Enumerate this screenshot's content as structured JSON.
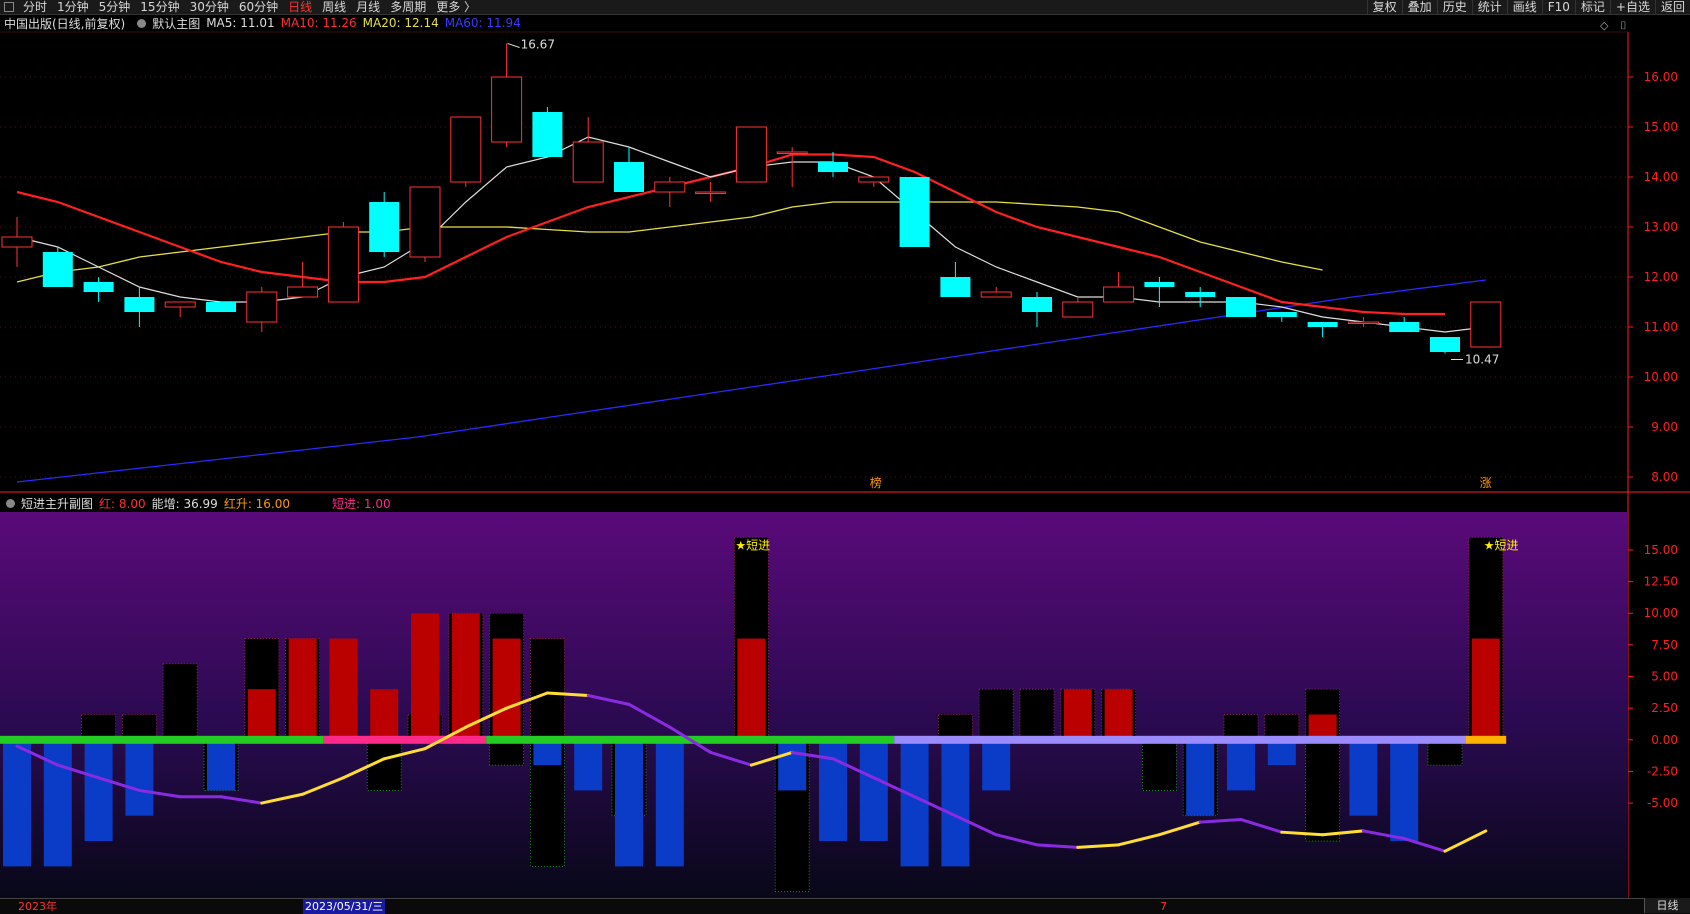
{
  "toolbar": {
    "left_items": [
      "分时",
      "1分钟",
      "5分钟",
      "15分钟",
      "30分钟",
      "60分钟",
      "日线",
      "周线",
      "月线",
      "多周期",
      "更多 〉"
    ],
    "active_item": "日线",
    "right_items": [
      "复权",
      "叠加",
      "历史",
      "统计",
      "画线",
      "F10",
      "标记",
      "+自选",
      "返回"
    ]
  },
  "main_header": {
    "stock": "中国出版(日线,前复权)",
    "template": "默认主图",
    "ma5": "MA5: 11.01",
    "ma10": "MA10: 11.26",
    "ma20": "MA20: 12.14",
    "ma60": "MA60: 11.94"
  },
  "window_controls": [
    "◇",
    "⌷"
  ],
  "sub_header": {
    "name": "短进主升副图",
    "hong": "红: 8.00",
    "nengzeng": "能增: 36.99",
    "hongsheng": "红升: 16.00",
    "duanjin": "短进: 1.00"
  },
  "annotations": {
    "high_label": "16.67",
    "low_label": "10.47",
    "marker_bang": "榜",
    "marker_zhang": "涨",
    "signal1": "★短进",
    "signal2": "★短进"
  },
  "colors": {
    "up": "#ff3333",
    "down": "#00ffff",
    "ma5": "#dddddd",
    "ma10": "#ff2020",
    "ma20": "#e8e040",
    "ma60": "#2a2aff",
    "axis": "#ff2020"
  },
  "status_bar": {
    "year": "2023年",
    "date": "2023/05/31/三",
    "month_mark": "7",
    "period_button": "日线"
  },
  "chart_data": [
    {
      "type": "candlestick",
      "title": "中国出版(日线,前复权)",
      "ylim": [
        7.7,
        16.9
      ],
      "yticks": [
        "16.00",
        "15.00",
        "14.00",
        "13.00",
        "12.00",
        "11.00",
        "10.00",
        "9.00",
        "8.00"
      ],
      "ytick_values": [
        16,
        15,
        14,
        13,
        12,
        11,
        10,
        9,
        8
      ],
      "candles": [
        {
          "o": 12.6,
          "h": 13.2,
          "l": 12.2,
          "c": 12.8
        },
        {
          "o": 12.5,
          "h": 12.6,
          "l": 11.8,
          "c": 11.8
        },
        {
          "o": 11.9,
          "h": 12.0,
          "l": 11.5,
          "c": 11.7
        },
        {
          "o": 11.6,
          "h": 11.8,
          "l": 11.0,
          "c": 11.3
        },
        {
          "o": 11.4,
          "h": 11.5,
          "l": 11.2,
          "c": 11.5
        },
        {
          "o": 11.5,
          "h": 11.5,
          "l": 11.3,
          "c": 11.3
        },
        {
          "o": 11.1,
          "h": 11.8,
          "l": 10.9,
          "c": 11.7
        },
        {
          "o": 11.6,
          "h": 12.3,
          "l": 11.6,
          "c": 11.8
        },
        {
          "o": 11.5,
          "h": 13.1,
          "l": 11.5,
          "c": 13.0
        },
        {
          "o": 13.5,
          "h": 13.7,
          "l": 12.4,
          "c": 12.5
        },
        {
          "o": 12.4,
          "h": 13.8,
          "l": 12.3,
          "c": 13.8
        },
        {
          "o": 13.9,
          "h": 15.2,
          "l": 13.8,
          "c": 15.2
        },
        {
          "o": 14.7,
          "h": 16.67,
          "l": 14.6,
          "c": 16.0
        },
        {
          "o": 15.3,
          "h": 15.4,
          "l": 14.4,
          "c": 14.4
        },
        {
          "o": 13.9,
          "h": 15.2,
          "l": 13.9,
          "c": 14.7
        },
        {
          "o": 14.3,
          "h": 14.6,
          "l": 13.7,
          "c": 13.7
        },
        {
          "o": 13.7,
          "h": 14.0,
          "l": 13.4,
          "c": 13.9
        },
        {
          "o": 13.7,
          "h": 13.9,
          "l": 13.5,
          "c": 13.7
        },
        {
          "o": 13.9,
          "h": 15.0,
          "l": 13.9,
          "c": 15.0
        },
        {
          "o": 14.5,
          "h": 14.6,
          "l": 13.8,
          "c": 14.5
        },
        {
          "o": 14.3,
          "h": 14.5,
          "l": 14.0,
          "c": 14.1
        },
        {
          "o": 13.9,
          "h": 14.0,
          "l": 13.8,
          "c": 14.0
        },
        {
          "o": 14.0,
          "h": 14.0,
          "l": 12.6,
          "c": 12.6
        },
        {
          "o": 12.0,
          "h": 12.3,
          "l": 11.6,
          "c": 11.6
        },
        {
          "o": 11.6,
          "h": 11.8,
          "l": 11.6,
          "c": 11.7
        },
        {
          "o": 11.6,
          "h": 11.7,
          "l": 11.0,
          "c": 11.3
        },
        {
          "o": 11.2,
          "h": 11.6,
          "l": 11.2,
          "c": 11.5
        },
        {
          "o": 11.5,
          "h": 12.1,
          "l": 11.5,
          "c": 11.8
        },
        {
          "o": 11.9,
          "h": 12.0,
          "l": 11.4,
          "c": 11.8
        },
        {
          "o": 11.7,
          "h": 11.8,
          "l": 11.4,
          "c": 11.6
        },
        {
          "o": 11.6,
          "h": 11.6,
          "l": 11.2,
          "c": 11.2
        },
        {
          "o": 11.3,
          "h": 11.3,
          "l": 11.1,
          "c": 11.2
        },
        {
          "o": 11.1,
          "h": 11.1,
          "l": 10.8,
          "c": 11.0
        },
        {
          "o": 11.1,
          "h": 11.2,
          "l": 11.0,
          "c": 11.1
        },
        {
          "o": 11.1,
          "h": 11.2,
          "l": 10.9,
          "c": 10.9
        },
        {
          "o": 10.8,
          "h": 10.8,
          "l": 10.47,
          "c": 10.5
        },
        {
          "o": 10.6,
          "h": 11.5,
          "l": 10.6,
          "c": 11.5
        }
      ],
      "ma5": [
        12.8,
        12.6,
        12.2,
        11.8,
        11.6,
        11.5,
        11.5,
        11.6,
        12.0,
        12.2,
        12.7,
        13.5,
        14.2,
        14.4,
        14.8,
        14.6,
        14.3,
        14.0,
        14.2,
        14.3,
        14.3,
        14.0,
        13.3,
        12.6,
        12.2,
        11.9,
        11.6,
        11.6,
        11.5,
        11.5,
        11.5,
        11.4,
        11.2,
        11.1,
        11.0,
        10.9,
        11.0
      ],
      "ma10": [
        13.7,
        13.5,
        13.2,
        12.9,
        12.6,
        12.3,
        12.1,
        12.0,
        11.9,
        11.9,
        12.0,
        12.4,
        12.8,
        13.1,
        13.4,
        13.6,
        13.8,
        14.0,
        14.2,
        14.45,
        14.45,
        14.4,
        14.1,
        13.7,
        13.3,
        13.0,
        12.8,
        12.6,
        12.4,
        12.1,
        11.8,
        11.5,
        11.4,
        11.3,
        11.26,
        11.26
      ],
      "ma20": [
        11.9,
        12.1,
        12.2,
        12.4,
        12.5,
        12.6,
        12.7,
        12.8,
        12.9,
        12.9,
        13.0,
        13.0,
        13.0,
        12.95,
        12.9,
        12.9,
        13.0,
        13.1,
        13.2,
        13.4,
        13.5,
        13.5,
        13.5,
        13.5,
        13.5,
        13.45,
        13.4,
        13.3,
        13.0,
        12.7,
        12.5,
        12.3,
        12.14
      ],
      "ma60": [
        7.9,
        8.2,
        8.5,
        8.8,
        9.2,
        9.6,
        10.0,
        10.4,
        10.8,
        11.2,
        11.6,
        11.94
      ]
    },
    {
      "type": "bar",
      "title": "短进主升副图",
      "ylim": [
        -12.5,
        18.0
      ],
      "yticks": [
        "15.00",
        "12.50",
        "10.00",
        "7.50",
        "5.00",
        "2.50",
        "0.00",
        "-2.50",
        "-5.00"
      ],
      "ytick_values": [
        15,
        12.5,
        10,
        7.5,
        5,
        2.5,
        0,
        -2.5,
        -5
      ],
      "outline_bars": [
        0,
        0,
        2,
        2,
        6,
        0,
        8,
        8,
        0,
        0,
        2,
        10,
        10,
        8,
        0,
        0,
        0,
        0,
        16,
        0,
        0,
        0,
        0,
        2,
        4,
        4,
        4,
        4,
        0,
        0,
        2,
        2,
        4,
        0,
        0,
        0,
        16
      ],
      "red_bars": [
        0,
        0,
        0,
        0,
        0,
        0,
        4,
        8,
        8,
        4,
        10,
        10,
        8,
        0,
        0,
        0,
        0,
        0,
        8,
        0,
        0,
        0,
        0,
        0,
        0,
        0,
        4,
        4,
        0,
        0,
        0,
        0,
        2,
        0,
        0,
        0,
        8
      ],
      "blue_bars": [
        -10,
        -10,
        -8,
        -6,
        0,
        -4,
        0,
        0,
        0,
        0,
        0,
        0,
        0,
        -2,
        -4,
        -10,
        -10,
        0,
        0,
        -4,
        -8,
        -8,
        -10,
        -10,
        -4,
        0,
        0,
        0,
        0,
        -6,
        -4,
        -2,
        0,
        -6,
        -8,
        0,
        0
      ],
      "green_outline_neg": [
        0,
        0,
        0,
        0,
        0,
        -4,
        0,
        0,
        0,
        -4,
        0,
        0,
        -2,
        -10,
        0,
        -6,
        0,
        0,
        0,
        -12,
        0,
        0,
        0,
        0,
        0,
        0,
        0,
        0,
        -4,
        -6,
        0,
        0,
        -8,
        0,
        0,
        -2,
        0
      ],
      "zero_band": [
        {
          "from": 0,
          "to": 7,
          "color": "#22cc22"
        },
        {
          "from": 8,
          "to": 11,
          "color": "#ff2a8a"
        },
        {
          "from": 12,
          "to": 21,
          "color": "#22cc22"
        },
        {
          "from": 22,
          "to": 35,
          "color": "#9a8cff"
        },
        {
          "from": 36,
          "to": 36,
          "color": "#ffb000"
        }
      ],
      "line": [
        -0.5,
        -2.0,
        -3.0,
        -4.0,
        -4.5,
        -4.5,
        -5.0,
        -4.3,
        -3.0,
        -1.5,
        -0.7,
        1.0,
        2.5,
        3.7,
        3.5,
        2.8,
        1.0,
        -1.0,
        -2.0,
        -1.0,
        -1.5,
        -3.0,
        -4.5,
        -6.0,
        -7.5,
        -8.3,
        -8.5,
        -8.3,
        -7.5,
        -6.5,
        -6.3,
        -7.3,
        -7.5,
        -7.2,
        -7.8,
        -8.8,
        -7.2
      ],
      "line_colors": [
        "#8a2be2",
        "#8a2be2",
        "#8a2be2",
        "#8a2be2",
        "#8a2be2",
        "#8a2be2",
        "#ffdd33",
        "#ffdd33",
        "#ffdd33",
        "#ffdd33",
        "#ffdd33",
        "#ffdd33",
        "#ffdd33",
        "#ffdd33",
        "#8a2be2",
        "#8a2be2",
        "#8a2be2",
        "#8a2be2",
        "#ffdd33",
        "#8a2be2",
        "#8a2be2",
        "#8a2be2",
        "#8a2be2",
        "#8a2be2",
        "#8a2be2",
        "#8a2be2",
        "#ffdd33",
        "#ffdd33",
        "#ffdd33",
        "#8a2be2",
        "#8a2be2",
        "#ffdd33",
        "#ffdd33",
        "#8a2be2",
        "#8a2be2",
        "#ffdd33"
      ]
    }
  ]
}
